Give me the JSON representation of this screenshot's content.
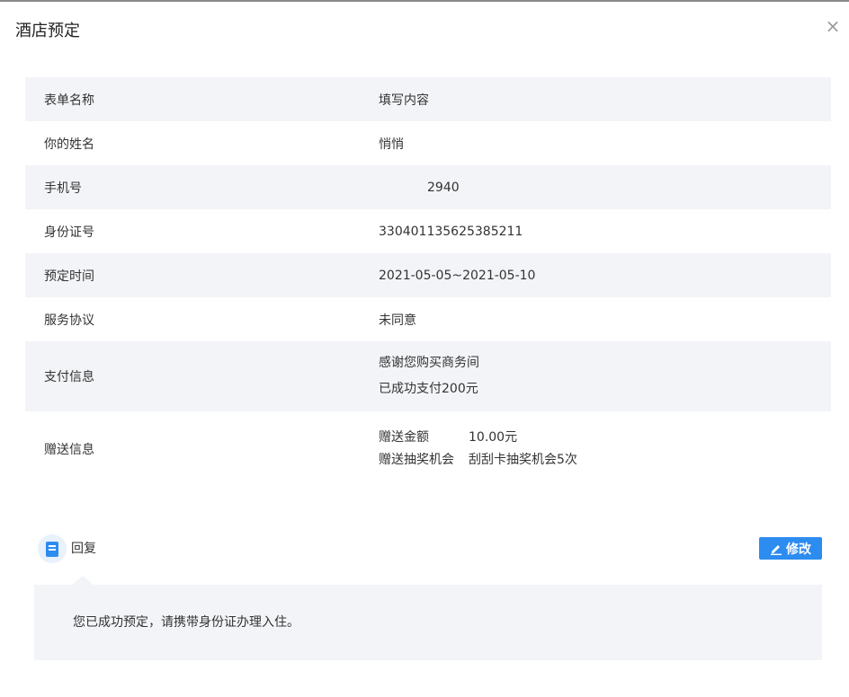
{
  "dialog": {
    "title": "酒店预定",
    "close_icon": "×"
  },
  "form": {
    "header": {
      "label": "表单名称",
      "value": "填写内容"
    },
    "rows": [
      {
        "label": "你的姓名",
        "value": "悄悄"
      },
      {
        "label": "手机号",
        "value": "2940"
      },
      {
        "label": "身份证号",
        "value": "330401135625385211"
      },
      {
        "label": "预定时间",
        "value": "2021-05-05~2021-05-10"
      },
      {
        "label": "服务协议",
        "value": "未同意"
      }
    ],
    "payment": {
      "label": "支付信息",
      "lines": [
        "感谢您购买商务间",
        "已成功支付200元"
      ]
    },
    "gift": {
      "label": "赠送信息",
      "items": [
        {
          "key": "赠送金额",
          "value": "10.00元"
        },
        {
          "key": "赠送抽奖机会",
          "value": "刮刮卡抽奖机会5次"
        }
      ]
    }
  },
  "reply": {
    "label": "回复",
    "edit_label": "修改",
    "text": "您已成功预定，请携带身份证办理入住。"
  },
  "colors": {
    "accent": "#2d8cf0",
    "row_shade": "#f2f4f7"
  }
}
